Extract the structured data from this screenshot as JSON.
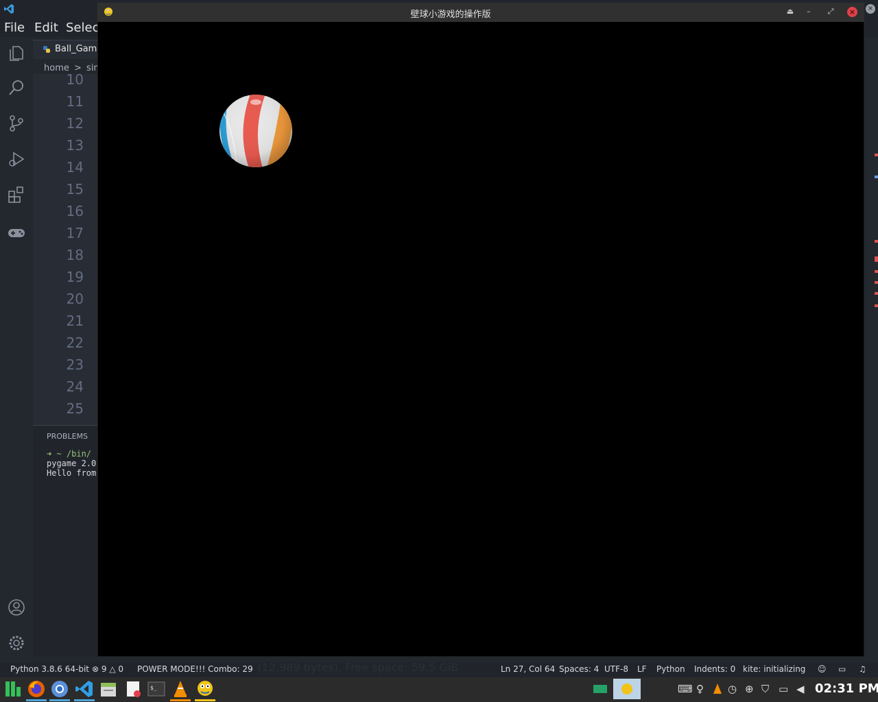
{
  "vscode": {
    "menu": {
      "file": "File",
      "edit": "Edit",
      "selection": "Selec"
    },
    "tab": {
      "label": "Ball_Game"
    },
    "breadcrumb": {
      "home": "home",
      "sep": ">",
      "next": "simo"
    },
    "line_numbers": [
      "10",
      "11",
      "12",
      "13",
      "14",
      "15",
      "16",
      "17",
      "18",
      "19",
      "20",
      "21",
      "22",
      "23",
      "24",
      "25"
    ],
    "panel": {
      "problems_label": "PROBLEMS",
      "terminal_lines": [
        "➜ ~ /bin/",
        "pygame 2.0",
        "Hello from"
      ]
    }
  },
  "statusbar": {
    "python": "Python 3.8.6 64-bit",
    "errors": "9",
    "warnings": "0",
    "power_mode": "POWER MODE!!! Combo: 29",
    "ghost_text": "s (12,989 bytes), Free space: 59.5 GiB",
    "position": "Ln 27, Col 64",
    "spaces": "Spaces: 4",
    "encoding": "UTF-8",
    "eol": "LF",
    "language": "Python",
    "indents": "Indents: 0",
    "kite": "kite: initializing"
  },
  "pygame_window": {
    "title": "壁球小游戏的操作版"
  },
  "taskbar": {
    "clock": "02:31 PM",
    "apps": [
      "manjaro-menu-icon",
      "firefox-icon",
      "chromium-icon",
      "vscode-icon",
      "file-manager-icon",
      "text-editor-icon",
      "terminal-icon",
      "vlc-icon",
      "pygame-icon"
    ]
  },
  "colors": {
    "canvas_bg": "#000000",
    "close_red": "#e0404a",
    "accent_blue": "#4fa3d9"
  }
}
